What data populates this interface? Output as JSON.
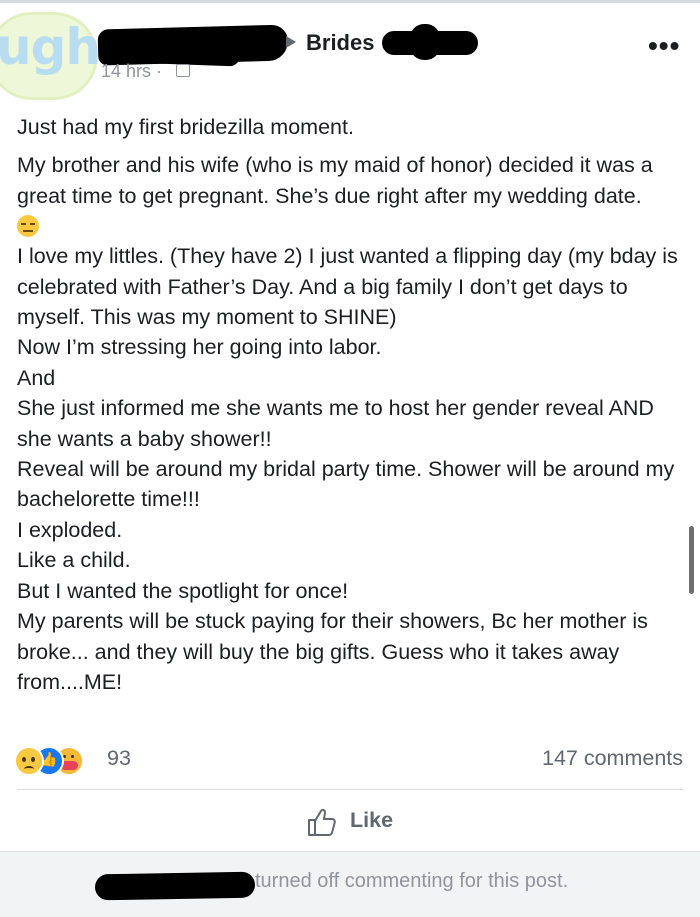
{
  "sticker": {
    "text": "ugh"
  },
  "header": {
    "group_name": "Brides",
    "timestamp": "14 hrs ·",
    "audience_icon": "group-icon",
    "more_icon": "•••"
  },
  "body": {
    "paragraph1": "Just had my first bridezilla moment.",
    "paragraph2": "My brother and his wife (who is my maid of honor) decided it was a great time to get pregnant. She’s due right after my wedding date.",
    "emoji": "expressionless-face-icon",
    "paragraph3": "I love my littles. (They have 2) I just wanted a flipping day (my bday is celebrated with Father’s Day. And a big family I don’t get days to myself. This was my moment to SHINE)\nNow I’m stressing her going into labor.\nAnd\nShe just informed me she wants me to host her gender reveal AND she wants a baby shower!!\nReveal will be around my bridal party time. Shower will be around my bachelorette time!!!\nI exploded.\nLike a child.\nBut I wanted the spotlight for once!\nMy parents will be stuck paying for their showers, Bc her mother is broke... and they will buy the big gifts. Guess who it takes away from....ME!"
  },
  "reactions": {
    "icons": [
      "sad-reaction-icon",
      "like-reaction-icon",
      "care-reaction-icon"
    ],
    "count": "93",
    "comments": "147 comments"
  },
  "actions": {
    "like_label": "Like"
  },
  "footer": {
    "text": "turned off commenting for this post."
  },
  "colors": {
    "text": "#1c1e21",
    "secondary": "#606770",
    "muted": "#90949c",
    "footer_bg": "#f2f3f5",
    "like_blue": "#1877f2"
  }
}
